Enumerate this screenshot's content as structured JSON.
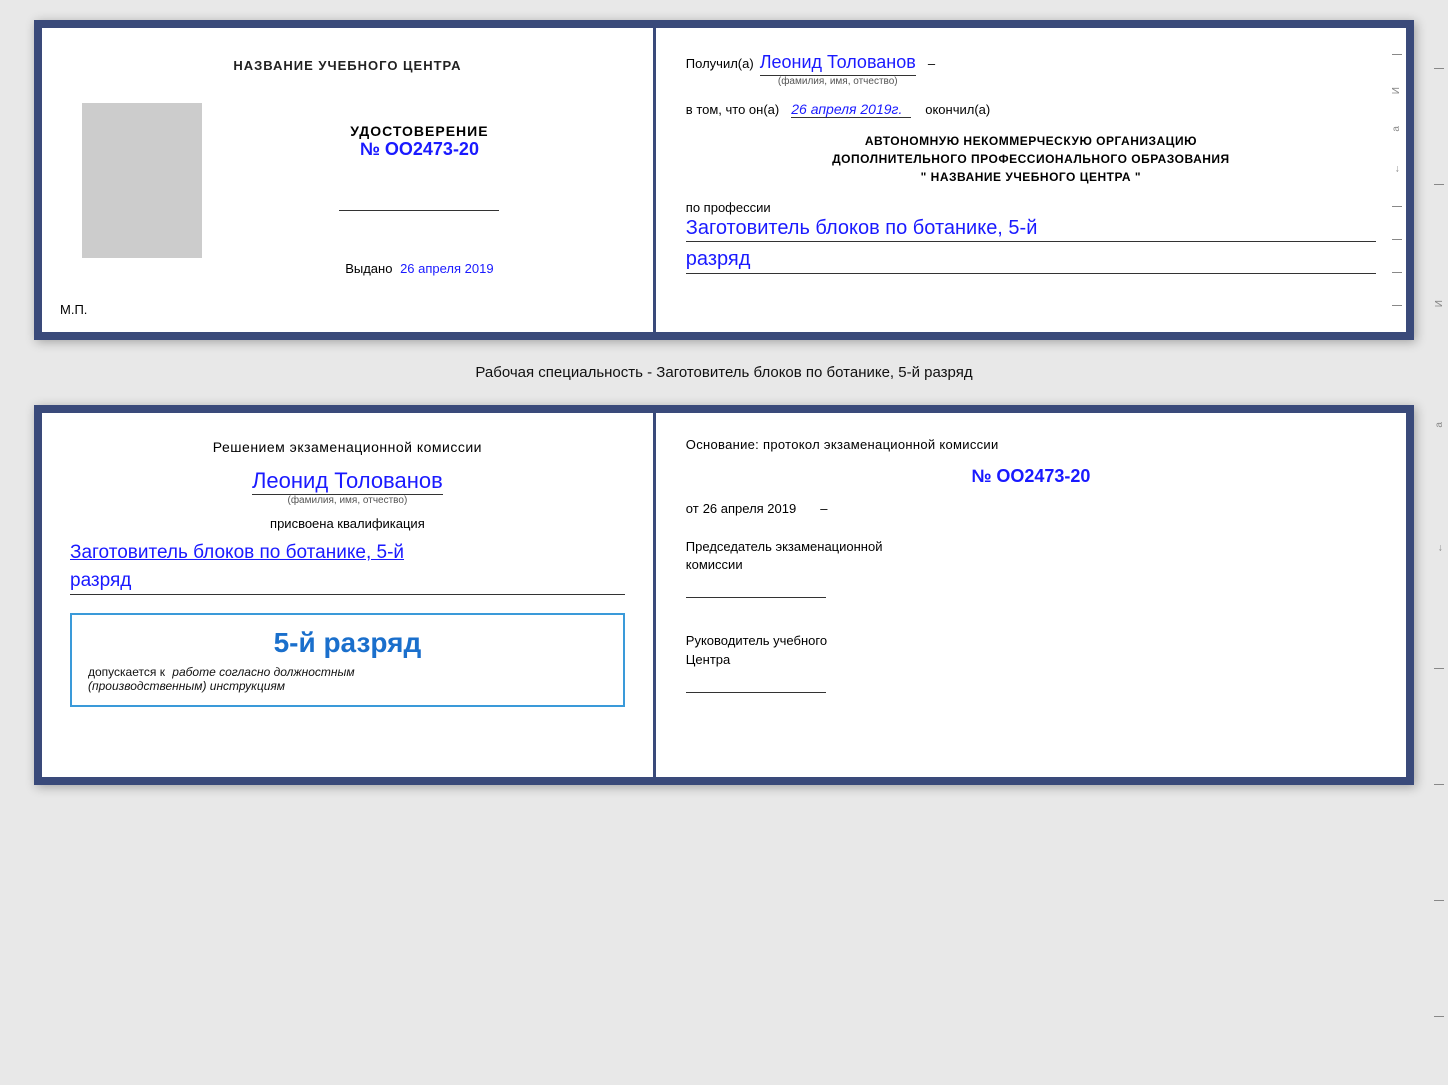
{
  "top_cert": {
    "left": {
      "title": "НАЗВАНИЕ УЧЕБНОГО ЦЕНТРА",
      "udost_label": "УДОСТОВЕРЕНИЕ",
      "udost_number": "№ OO2473-20",
      "vydano_label": "Выдано",
      "vydano_date": "26 апреля 2019",
      "mp_label": "М.П."
    },
    "right": {
      "poluchil_prefix": "Получил(а)",
      "recipient_name": "Леонид Толованов",
      "fio_sub": "(фамилия, имя, отчество)",
      "dash": "–",
      "vtom_prefix": "в том, что он(а)",
      "vtom_date": "26 апреля 2019г.",
      "okonchil": "окончил(а)",
      "org_line1": "АВТОНОМНУЮ НЕКОММЕРЧЕСКУЮ ОРГАНИЗАЦИЮ",
      "org_line2": "ДОПОЛНИТЕЛЬНОГО ПРОФЕССИОНАЛЬНОГО ОБРАЗОВАНИЯ",
      "org_line3": "\"   НАЗВАНИЕ УЧЕБНОГО ЦЕНТРА   \"",
      "po_professii": "по профессии",
      "profession": "Заготовитель блоков по ботанике, 5-й",
      "razryad": "разряд"
    }
  },
  "separator": {
    "text": "Рабочая специальность - Заготовитель блоков по ботанике, 5-й разряд"
  },
  "bottom_cert": {
    "left": {
      "decision_line1": "Решением экзаменационной комиссии",
      "person_name": "Леонид Толованов",
      "fio_sub": "(фамилия, имя, отчество)",
      "prisvoena": "присвоена квалификация",
      "qualification": "Заготовитель блоков по ботанике, 5-й",
      "razryad": "разряд",
      "stamp_big": "5-й разряд",
      "stamp_dopuskaetsya": "допускается к",
      "stamp_rabote": "работе согласно должностным",
      "stamp_instruktsiyam": "(производственным) инструкциям"
    },
    "right": {
      "osnov_label": "Основание: протокол экзаменационной комиссии",
      "proto_number": "№ OO2473-20",
      "ot_prefix": "от",
      "ot_date": "26 апреля 2019",
      "chairman_label": "Председатель экзаменационной",
      "chairman_label2": "комиссии",
      "ruk_label": "Руководитель учебного",
      "ruk_label2": "Центра"
    }
  }
}
